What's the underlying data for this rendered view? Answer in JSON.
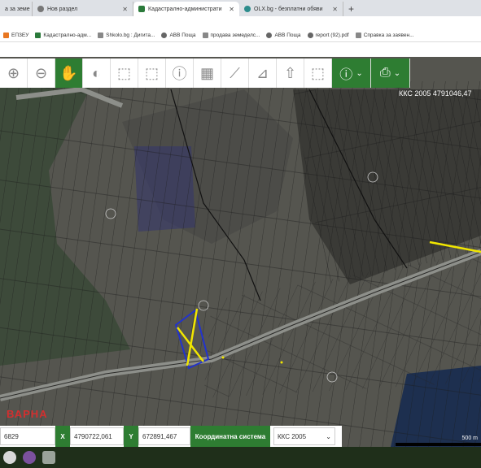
{
  "browser": {
    "tabs": [
      {
        "label": "а за земе",
        "active": false
      },
      {
        "label": "Нов раздел",
        "active": false
      },
      {
        "label": "Кадастрално-административн",
        "active": true
      },
      {
        "label": "OLX.bg - безплатни обяви",
        "active": false
      }
    ],
    "new_tab": "+",
    "bookmarks": [
      {
        "label": "ЕПЗЕУ",
        "icon": "orange"
      },
      {
        "label": "Кадастрално-адм...",
        "icon": "green"
      },
      {
        "label": "Shkolo.bg : Дигита...",
        "icon": "gray"
      },
      {
        "label": "АВВ Поща",
        "icon": "globe"
      },
      {
        "label": "продава земеделс...",
        "icon": "gray"
      },
      {
        "label": "АВВ Поща",
        "icon": "globe"
      },
      {
        "label": "report (92).pdf",
        "icon": "globe"
      },
      {
        "label": "Справка за заявен...",
        "icon": "gray"
      }
    ]
  },
  "toolbar": {
    "tools": [
      {
        "name": "zoom-in-icon",
        "glyph": "⊕"
      },
      {
        "name": "zoom-out-icon",
        "glyph": "⊖"
      },
      {
        "name": "pan-hand-icon",
        "glyph": "✋",
        "active": true
      },
      {
        "name": "globe-icon",
        "glyph": "◐"
      },
      {
        "name": "select-rectangle-icon",
        "glyph": "⬚"
      },
      {
        "name": "select-rectangle-minus-icon",
        "glyph": "⬚"
      },
      {
        "name": "info-icon",
        "glyph": "ⓘ"
      },
      {
        "name": "building-icon",
        "glyph": "▦"
      },
      {
        "name": "ruler-icon",
        "glyph": "⟋"
      },
      {
        "name": "polygon-area-icon",
        "glyph": "⊿"
      },
      {
        "name": "upload-icon",
        "glyph": "⇧"
      },
      {
        "name": "select-cursor-icon",
        "glyph": "⬚"
      }
    ],
    "layers_glyph": "ⓘ",
    "print_glyph": "⎙",
    "caret": "⌄"
  },
  "map": {
    "top_coords": "ККС 2005 4791046,47",
    "city_label": "ВАРНА",
    "scale_label": "500 m"
  },
  "bottom": {
    "field1": "6829",
    "x_label": "X",
    "x_value": "4790722,061",
    "y_label": "Y",
    "y_value": "672891,467",
    "coord_system_label": "Координатна система",
    "coord_system_value": "ККС 2005"
  },
  "colors": {
    "accent": "#2e7d32",
    "highlight": "#f1e600",
    "selection": "#2233cc"
  }
}
